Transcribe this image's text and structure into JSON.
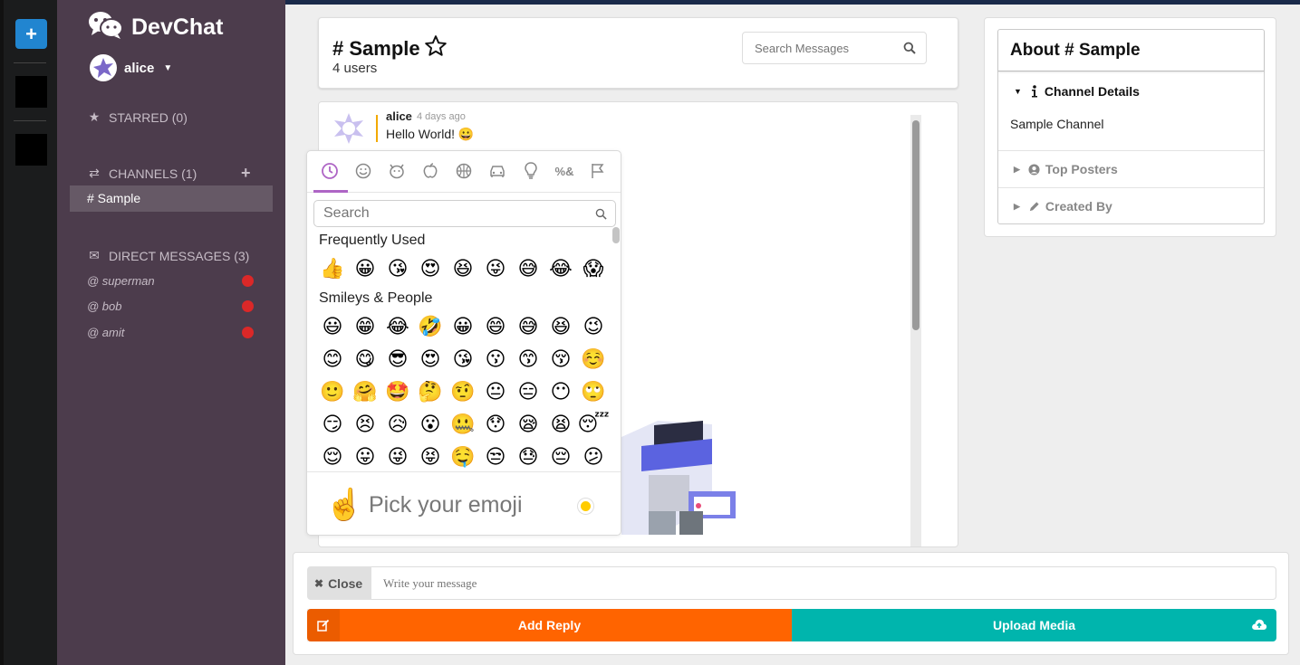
{
  "app": {
    "name": "DevChat"
  },
  "colors": {
    "sidebar": "#4c3c4c",
    "accent_blue": "#2185d0",
    "add_reply": "#ff6400",
    "upload": "#00b5ad",
    "emoji_tab": "#ae65c5",
    "status_dot": "#db2828"
  },
  "strip": {
    "add_label": "+"
  },
  "sidebar": {
    "user": "alice",
    "starred": "STARRED (0)",
    "channels": "CHANNELS (1)",
    "channels_add": "+",
    "channel_items": [
      "# Sample"
    ],
    "direct_messages": "DIRECT MESSAGES (3)",
    "dms": [
      "@ superman",
      "@ bob",
      "@ amit"
    ]
  },
  "channel": {
    "title": "# Sample",
    "users": "4 users",
    "search_placeholder": "Search Messages"
  },
  "message": {
    "author": "alice",
    "time": "4 days ago",
    "text": "Hello World! 😀"
  },
  "emoji_picker": {
    "categories": [
      "recent-icon",
      "smileys-icon",
      "animals-icon",
      "food-icon",
      "activity-icon",
      "travel-icon",
      "objects-icon",
      "symbols-icon",
      "flags-icon"
    ],
    "search_placeholder": "Search",
    "frequently_used_label": "Frequently Used",
    "frequently_used": [
      "👍",
      "😀",
      "😘",
      "😍",
      "😆",
      "😜",
      "😅",
      "😂",
      "😱"
    ],
    "smileys_label": "Smileys & People",
    "smileys": [
      [
        "😃",
        "😁",
        "😂",
        "🤣",
        "😀",
        "😄",
        "😅",
        "😆",
        "😉"
      ],
      [
        "😊",
        "😋",
        "😎",
        "😍",
        "😘",
        "😗",
        "😙",
        "😚",
        "☺️"
      ],
      [
        "🙂",
        "🤗",
        "🤩",
        "🤔",
        "🤨",
        "😐",
        "😑",
        "😶",
        "🙄"
      ],
      [
        "😏",
        "😣",
        "😥",
        "😮",
        "🤐",
        "😯",
        "😪",
        "😫",
        "😴"
      ],
      [
        "😌",
        "😛",
        "😜",
        "😝",
        "🤤",
        "😒",
        "😓",
        "😔",
        "😕"
      ]
    ],
    "footer_emoji": "☝️",
    "footer_text": "Pick your emoji"
  },
  "about": {
    "title": "About # Sample",
    "details_label": "Channel Details",
    "details_text": "Sample Channel",
    "top_posters": "Top Posters",
    "created_by": "Created By"
  },
  "reply": {
    "close_label": "Close",
    "input_placeholder": "Write your message",
    "add_reply": "Add Reply",
    "upload_media": "Upload Media"
  }
}
